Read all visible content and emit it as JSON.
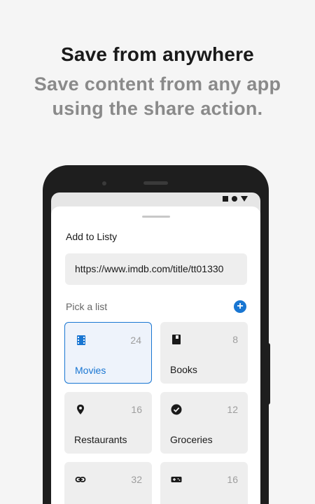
{
  "headline": "Save from anywhere",
  "subheadline": "Save content from any app using the share action.",
  "sheet": {
    "title": "Add to Listy",
    "url_value": "https://www.imdb.com/title/tt01330",
    "pick_label": "Pick a list",
    "add_label": "+"
  },
  "lists": [
    {
      "label": "Movies",
      "count": "24",
      "icon": "film-icon",
      "selected": true
    },
    {
      "label": "Books",
      "count": "8",
      "icon": "book-icon",
      "selected": false
    },
    {
      "label": "Restaurants",
      "count": "16",
      "icon": "location-pin-icon",
      "selected": false
    },
    {
      "label": "Groceries",
      "count": "12",
      "icon": "check-circle-icon",
      "selected": false
    },
    {
      "label": "",
      "count": "32",
      "icon": "link-icon",
      "selected": false
    },
    {
      "label": "",
      "count": "16",
      "icon": "gamepad-icon",
      "selected": false
    }
  ],
  "colors": {
    "accent": "#1976d2",
    "background": "#f5f5f5"
  }
}
